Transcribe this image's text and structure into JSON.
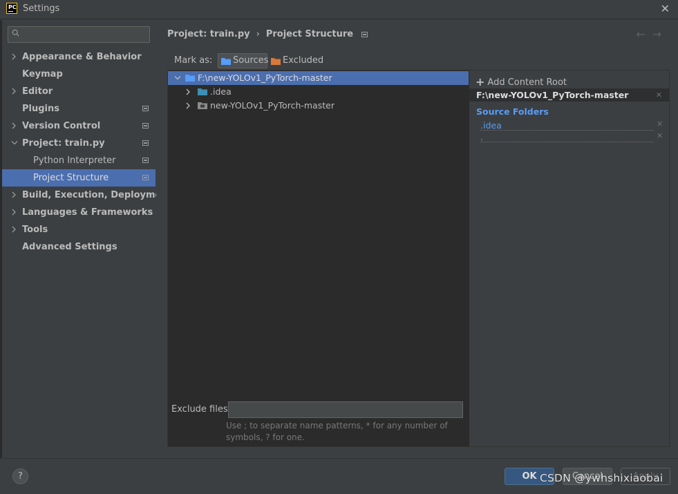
{
  "window": {
    "app_icon_text": "PC",
    "title": "Settings",
    "close_glyph": "✕"
  },
  "search": {
    "value": "",
    "placeholder": ""
  },
  "sidebar": {
    "items": [
      {
        "label": "Appearance & Behavior",
        "expandable": true,
        "expanded": false
      },
      {
        "label": "Keymap",
        "expandable": false
      },
      {
        "label": "Editor",
        "expandable": true,
        "expanded": false
      },
      {
        "label": "Plugins",
        "expandable": false,
        "badge": "project-icon"
      },
      {
        "label": "Version Control",
        "expandable": true,
        "expanded": false,
        "badge": "project-icon"
      },
      {
        "label": "Project: train.py",
        "expandable": true,
        "expanded": true,
        "badge": "project-icon"
      },
      {
        "label": "Python Interpreter",
        "child": true,
        "badge": "project-icon"
      },
      {
        "label": "Project Structure",
        "child": true,
        "selected": true,
        "badge": "project-icon"
      },
      {
        "label": "Build, Execution, Deployment",
        "expandable": true,
        "expanded": false
      },
      {
        "label": "Languages & Frameworks",
        "expandable": true,
        "expanded": false
      },
      {
        "label": "Tools",
        "expandable": true,
        "expanded": false
      },
      {
        "label": "Advanced Settings",
        "expandable": false
      }
    ]
  },
  "header": {
    "breadcrumb_parent": "Project: train.py",
    "breadcrumb_separator": "›",
    "breadcrumb_current": "Project Structure",
    "back_arrow": "←",
    "forward_arrow": "→"
  },
  "toolbar": {
    "mark_as_label": "Mark as:",
    "sources_label": "Sources",
    "excluded_label": "Excluded"
  },
  "tree": {
    "root": "F:\\new-YOLOv1_PyTorch-master",
    "children": [
      {
        "label": ".idea"
      },
      {
        "label": "new-YOLOv1_PyTorch-master"
      }
    ]
  },
  "exclude": {
    "label": "Exclude files:",
    "value": "",
    "hint": "Use ; to separate name patterns, * for any number of symbols, ? for one."
  },
  "content_roots": {
    "add_label": "Add Content Root",
    "root_path": "F:\\new-YOLOv1_PyTorch-master",
    "source_folders_title": "Source Folders",
    "source_folders": [
      ".idea",
      "."
    ]
  },
  "footer": {
    "help_label": "?",
    "ok_label": "OK",
    "cancel_label": "Cancel",
    "apply_label": "Apply",
    "watermark": "CSDN @ywhshixiaobai"
  },
  "colors": {
    "background": "#3c3f41",
    "tree_background": "#2b2b2b",
    "selection": "#4b6eaf",
    "source_blue": "#589df6",
    "excluded_orange": "#d97a3b",
    "ok_button": "#365880"
  }
}
